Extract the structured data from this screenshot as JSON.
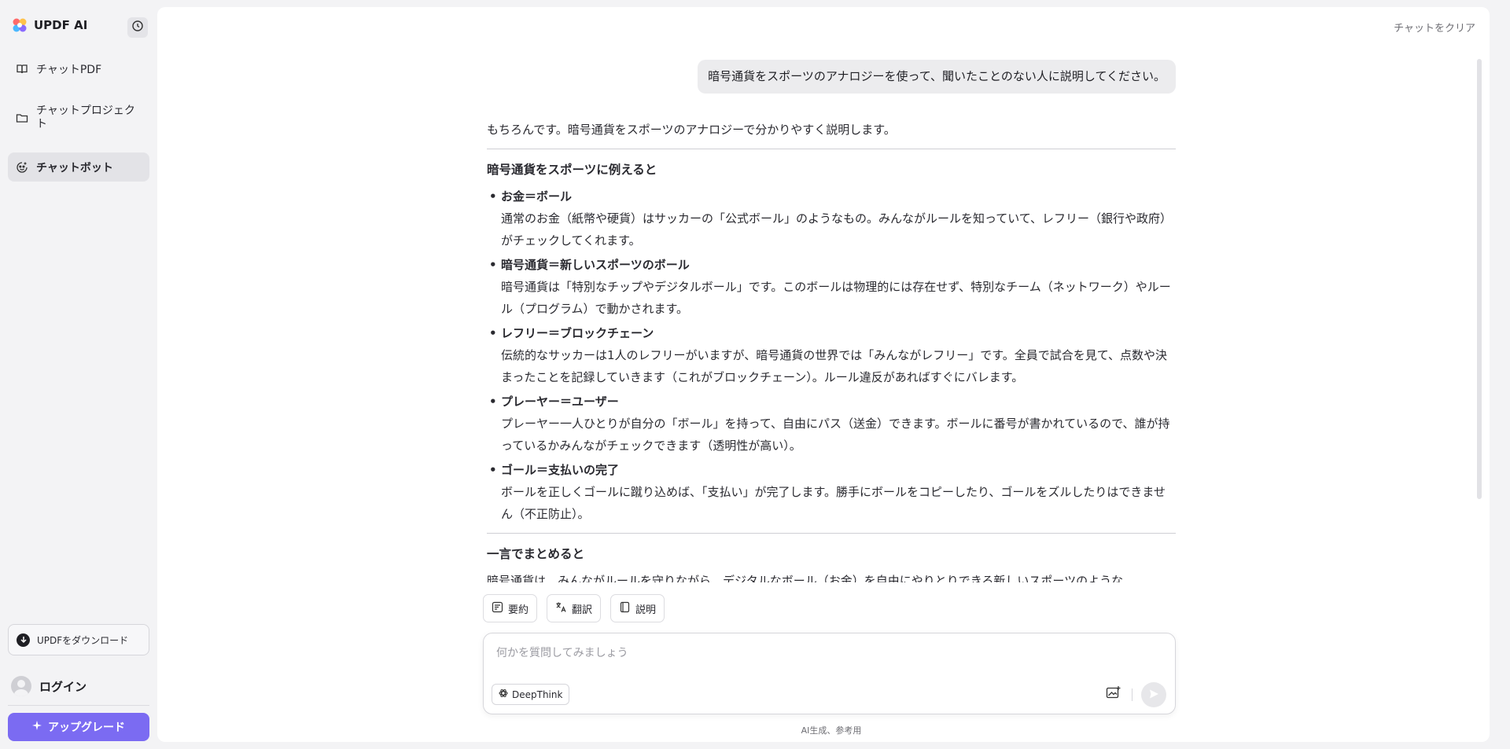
{
  "sidebar": {
    "brand": "UPDF AI",
    "items": [
      {
        "label": "チャットPDF",
        "icon": "book-icon"
      },
      {
        "label": "チャットプロジェクト",
        "icon": "folder-icon"
      },
      {
        "label": "チャットボット",
        "icon": "bot-icon",
        "active": true
      }
    ],
    "download_label": "UPDFをダウンロード",
    "login_label": "ログイン",
    "upgrade_label": "アップグレード"
  },
  "header": {
    "clear_label": "チャットをクリア"
  },
  "chat": {
    "user_message": "暗号通貨をスポーツのアナロジーを使って、聞いたことのない人に説明してください。",
    "answer": {
      "intro": "もちろんです。暗号通貨をスポーツのアナロジーで分かりやすく説明します。",
      "section1_title": "暗号通貨をスポーツに例えると",
      "items": [
        {
          "title": "お金＝ボール",
          "body": "通常のお金（紙幣や硬貨）はサッカーの「公式ボール」のようなもの。みんながルールを知っていて、レフリー（銀行や政府）がチェックしてくれます。"
        },
        {
          "title": "暗号通貨＝新しいスポーツのボール",
          "body": "暗号通貨は「特別なチップやデジタルボール」です。このボールは物理的には存在せず、特別なチーム（ネットワーク）やルール（プログラム）で動かされます。"
        },
        {
          "title": "レフリー＝ブロックチェーン",
          "body": "伝統的なサッカーは1人のレフリーがいますが、暗号通貨の世界では「みんながレフリー」です。全員で試合を見て、点数や決まったことを記録していきます（これがブロックチェーン）。ルール違反があればすぐにバレます。"
        },
        {
          "title": "プレーヤー＝ユーザー",
          "body": "プレーヤー一人ひとりが自分の「ボール」を持って、自由にパス（送金）できます。ボールに番号が書かれているので、誰が持っているかみんながチェックできます（透明性が高い）。"
        },
        {
          "title": "ゴール＝支払いの完了",
          "body": "ボールを正しくゴールに蹴り込めば、「支払い」が完了します。勝手にボールをコピーしたり、ゴールをズルしたりはできません（不正防止）。"
        }
      ],
      "section2_title": "一言でまとめると",
      "summary": "暗号通貨は、みんながルールを守りながら、デジタルなボール（お金）を自由にやりとりできる新しいスポーツのような"
    },
    "actions": [
      {
        "label": "要約",
        "icon": "summary-icon"
      },
      {
        "label": "翻訳",
        "icon": "translate-icon"
      },
      {
        "label": "説明",
        "icon": "explain-icon"
      }
    ]
  },
  "composer": {
    "placeholder": "何かを質問してみましょう",
    "deepthink_label": "DeepThink"
  },
  "footer_note": "AI生成、参考用",
  "colors": {
    "accent": "#7b6bf2",
    "panel_bg": "#ffffff",
    "sidebar_bg": "#f3f3f5"
  }
}
